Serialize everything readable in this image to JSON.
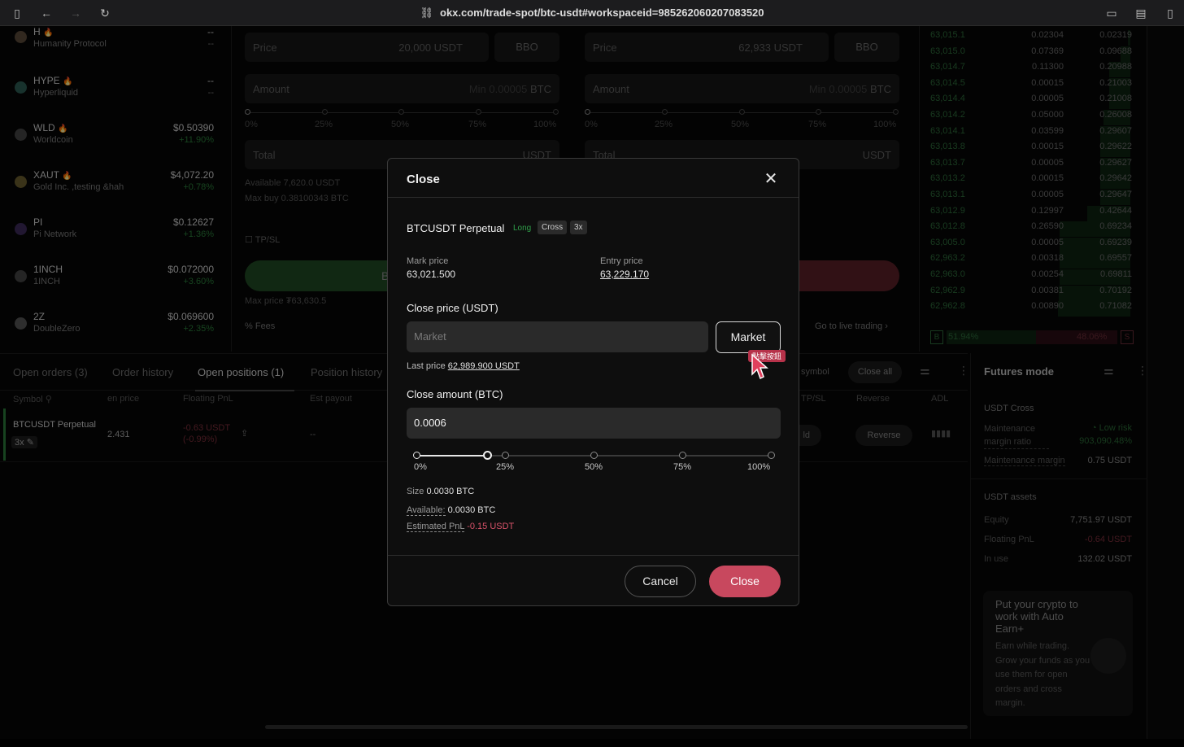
{
  "browser": {
    "url": "okx.com/trade-spot/btc-usdt#workspaceid=985262060207083520"
  },
  "markets": [
    {
      "symbol": "H",
      "name": "Humanity Protocol",
      "price": "--",
      "change": "--"
    },
    {
      "symbol": "HYPE",
      "name": "Hyperliquid",
      "price": "--",
      "change": "--"
    },
    {
      "symbol": "WLD",
      "name": "Worldcoin",
      "price": "$0.50390",
      "change": "+11.90%"
    },
    {
      "symbol": "XAUT",
      "name": "Gold Inc. ,testing &hah",
      "price": "$4,072.20",
      "change": "+0.78%"
    },
    {
      "symbol": "PI",
      "name": "Pi Network",
      "price": "$0.12627",
      "change": "+1.36%"
    },
    {
      "symbol": "1INCH",
      "name": "1INCH",
      "price": "$0.072000",
      "change": "+3.60%"
    },
    {
      "symbol": "2Z",
      "name": "DoubleZero",
      "price": "$0.069600",
      "change": "+2.35%"
    }
  ],
  "trade_form": {
    "buy": {
      "price_label": "Price",
      "price_value": "20,000",
      "price_unit": "USDT",
      "bbo": "BBO",
      "amount_label": "Amount",
      "amount_placeholder": "Min 0.00005",
      "amount_unit": "BTC",
      "total_label": "Total",
      "total_unit": "USDT",
      "available": "Available 7,620.0 USDT",
      "max_buy": "Max buy 0.38100343 BTC",
      "tpsl": "TP/SL",
      "mark_price": "Max price ₮63,630.5",
      "fees": "Fees",
      "buy_btn_letter": "B"
    },
    "sell": {
      "price_label": "Price",
      "price_value": "62,933",
      "price_unit": "USDT",
      "bbo": "BBO",
      "amount_label": "Amount",
      "amount_placeholder": "Min 0.00005",
      "amount_unit": "BTC",
      "total_label": "Total",
      "total_unit": "USDT",
      "go_live": "Go to live trading"
    },
    "slider_labels": [
      "0%",
      "25%",
      "50%",
      "75%",
      "100%"
    ]
  },
  "orderbook": [
    {
      "price": "63,015.1",
      "amount": "0.02304",
      "total": "0.02319"
    },
    {
      "price": "63,015.0",
      "amount": "0.07369",
      "total": "0.09688"
    },
    {
      "price": "63,014.7",
      "amount": "0.11300",
      "total": "0.20988"
    },
    {
      "price": "63,014.5",
      "amount": "0.00015",
      "total": "0.21003"
    },
    {
      "price": "63,014.4",
      "amount": "0.00005",
      "total": "0.21008"
    },
    {
      "price": "63,014.2",
      "amount": "0.05000",
      "total": "0.26008"
    },
    {
      "price": "63,014.1",
      "amount": "0.03599",
      "total": "0.29607"
    },
    {
      "price": "63,013.8",
      "amount": "0.00015",
      "total": "0.29622"
    },
    {
      "price": "63,013.7",
      "amount": "0.00005",
      "total": "0.29627"
    },
    {
      "price": "63,013.2",
      "amount": "0.00015",
      "total": "0.29642"
    },
    {
      "price": "63,013.1",
      "amount": "0.00005",
      "total": "0.29647"
    },
    {
      "price": "63,012.9",
      "amount": "0.12997",
      "total": "0.42644"
    },
    {
      "price": "63,012.8",
      "amount": "0.26590",
      "total": "0.69234"
    },
    {
      "price": "63,005.0",
      "amount": "0.00005",
      "total": "0.69239"
    },
    {
      "price": "62,963.2",
      "amount": "0.00318",
      "total": "0.69557"
    },
    {
      "price": "62,963.0",
      "amount": "0.00254",
      "total": "0.69811"
    },
    {
      "price": "62,962.9",
      "amount": "0.00381",
      "total": "0.70192"
    },
    {
      "price": "62,962.8",
      "amount": "0.00890",
      "total": "0.71082"
    }
  ],
  "orderbook_ratio": {
    "buy_letter": "B",
    "buy_pct": "51.94%",
    "sell_pct": "48.06%",
    "sell_letter": "S"
  },
  "bottom_tabs": {
    "tabs": [
      "Open orders (3)",
      "Order history",
      "Open positions (1)",
      "Position history"
    ],
    "symbol_filter": "symbol",
    "close_all": "Close all",
    "columns": [
      "Symbol",
      "en price",
      "Floating PnL",
      "Est payout",
      "TP/SL",
      "Reverse",
      "ADL"
    ],
    "row": {
      "symbol": "BTCUSDT Perpetual",
      "leverage": "3x",
      "entry": "2.431",
      "pnl": "-0.63 USDT",
      "pnl_pct": "(-0.99%)",
      "payout": "--",
      "tpsl_fragment": "ld",
      "reverse": "Reverse"
    }
  },
  "futures": {
    "title": "Futures mode",
    "usdt_cross": "USDT Cross",
    "mm_ratio_label": "Maintenance margin ratio",
    "risk": "Low risk",
    "mm_ratio": "903,090.48%",
    "mm_label": "Maintenance margin",
    "mm_value": "0.75 USDT",
    "assets_title": "USDT assets",
    "equity_label": "Equity",
    "equity": "7,751.97 USDT",
    "fpnl_label": "Floating PnL",
    "fpnl": "-0.64 USDT",
    "inuse_label": "In use",
    "inuse": "132.02 USDT",
    "promo_title": "Put your crypto to work with Auto Earn+",
    "promo_body": "Earn while trading. Grow your funds as you use them for open orders and cross margin."
  },
  "modal": {
    "title": "Close",
    "instrument": "BTCUSDT Perpetual",
    "side": "Long",
    "mode": "Cross",
    "leverage": "3x",
    "mark_price_label": "Mark price",
    "mark_price": "63,021.500",
    "entry_price_label": "Entry price",
    "entry_price": "63,229.170",
    "close_price_label": "Close price (USDT)",
    "close_price_placeholder": "Market",
    "market_button": "Market",
    "last_price_label": "Last price",
    "last_price": "62,989.900 USDT",
    "close_amount_label": "Close amount (BTC)",
    "close_amount": "0.0006",
    "slider_labels": [
      "0%",
      "25%",
      "50%",
      "75%",
      "100%"
    ],
    "slider_value_pct": 20,
    "size_label": "Size",
    "size": "0.0030 BTC",
    "available_label": "Available:",
    "available": "0.0030 BTC",
    "est_pnl_label": "Estimated PnL",
    "est_pnl": "-0.15 USDT",
    "cancel": "Cancel",
    "close": "Close"
  },
  "tooltip": "點擊按鈕",
  "colors": {
    "accent_red": "#c8485e",
    "green": "#2fa04a",
    "neg": "#d9536a"
  }
}
